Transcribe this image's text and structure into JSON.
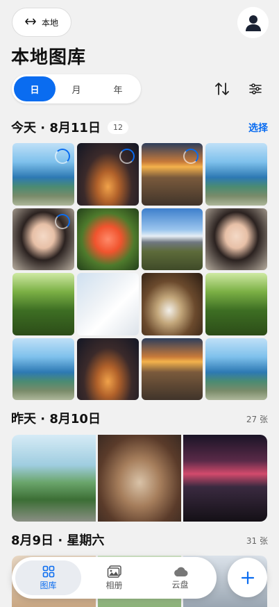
{
  "header": {
    "location_label": "本地",
    "title": "本地图库"
  },
  "view_modes": [
    {
      "label": "日",
      "active": true
    },
    {
      "label": "月",
      "active": false
    },
    {
      "label": "年",
      "active": false
    }
  ],
  "tools": [
    "sort-icon",
    "filter-icon"
  ],
  "sections": [
    {
      "title": "今天 ·  8月11日",
      "badge": "12",
      "action": "选择"
    },
    {
      "title": "昨天 ·  8月10日",
      "count": "27 张"
    },
    {
      "title": "8月9日 ·  星期六",
      "count": "31 张"
    }
  ],
  "today_photos": [
    {
      "scene": "sea-coast",
      "syncing": true
    },
    {
      "scene": "castle-night",
      "syncing": true
    },
    {
      "scene": "mountain-sunset",
      "syncing": true
    },
    {
      "scene": "sea-coast",
      "syncing": false
    },
    {
      "scene": "girl-portrait",
      "syncing": true
    },
    {
      "scene": "hibiscus-flower",
      "syncing": false
    },
    {
      "scene": "road-mountains",
      "syncing": false
    },
    {
      "scene": "girl-portrait",
      "syncing": false
    },
    {
      "scene": "forest",
      "syncing": false
    },
    {
      "scene": "white-architecture",
      "syncing": false
    },
    {
      "scene": "coffee-cup",
      "syncing": false
    },
    {
      "scene": "forest",
      "syncing": false
    },
    {
      "scene": "sea-coast",
      "syncing": false
    },
    {
      "scene": "castle-night",
      "syncing": false
    },
    {
      "scene": "mountain-sunset",
      "syncing": false
    },
    {
      "scene": "sea-coast",
      "syncing": false
    }
  ],
  "bottom_nav": [
    {
      "label": "图库",
      "icon": "grid-icon",
      "active": true
    },
    {
      "label": "相册",
      "icon": "album-icon",
      "active": false
    },
    {
      "label": "云盘",
      "icon": "cloud-icon",
      "active": false
    }
  ],
  "colors": {
    "accent": "#0a6cf0",
    "background": "#f1f1f1"
  }
}
